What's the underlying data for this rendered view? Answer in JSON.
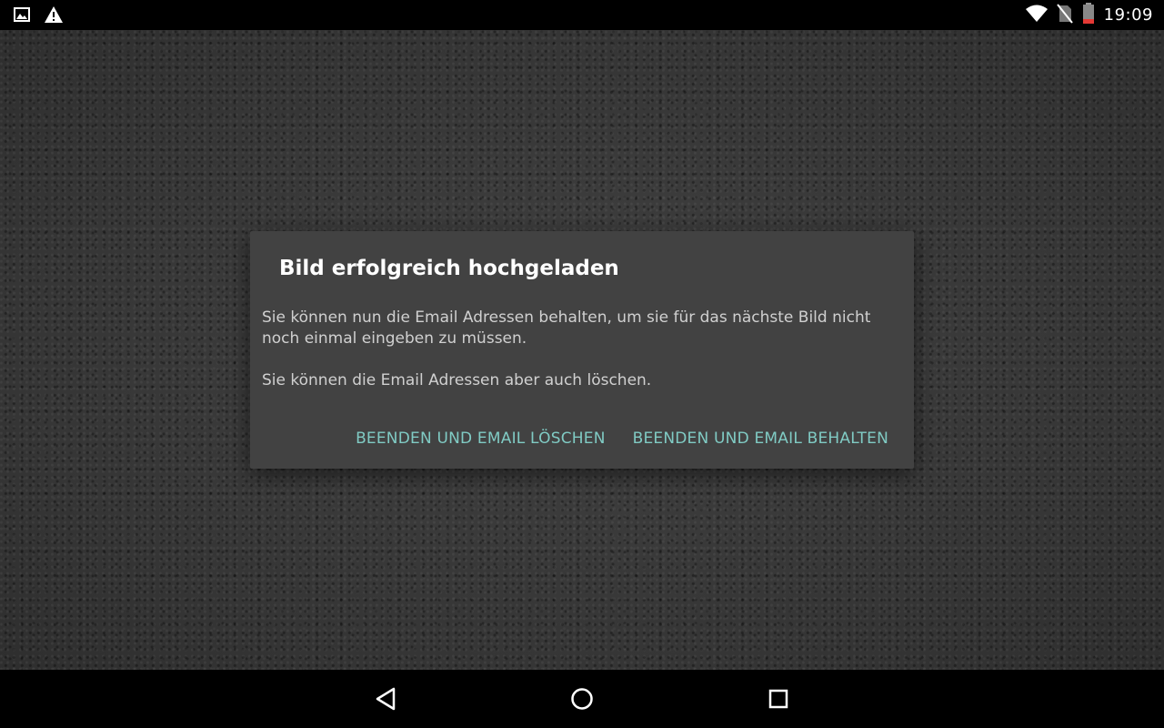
{
  "status_bar": {
    "time": "19:09",
    "left_icons": [
      "image-icon",
      "warning-icon"
    ],
    "right_icons": [
      "wifi-icon",
      "no-sim-icon",
      "battery-low-icon"
    ]
  },
  "dialog": {
    "title": "Bild erfolgreich hochgeladen",
    "message_1": "Sie können nun die Email Adressen behalten, um sie für das nächste Bild nicht noch einmal eingeben zu müssen.",
    "message_2": "Sie können die Email Adressen aber auch löschen.",
    "button_delete": "BEENDEN UND EMAIL LÖSCHEN",
    "button_keep": "BEENDEN UND EMAIL BEHALTEN",
    "accent_color": "#80cbc4"
  },
  "nav_bar": {
    "buttons": [
      "back-icon",
      "home-icon",
      "recents-icon"
    ]
  }
}
